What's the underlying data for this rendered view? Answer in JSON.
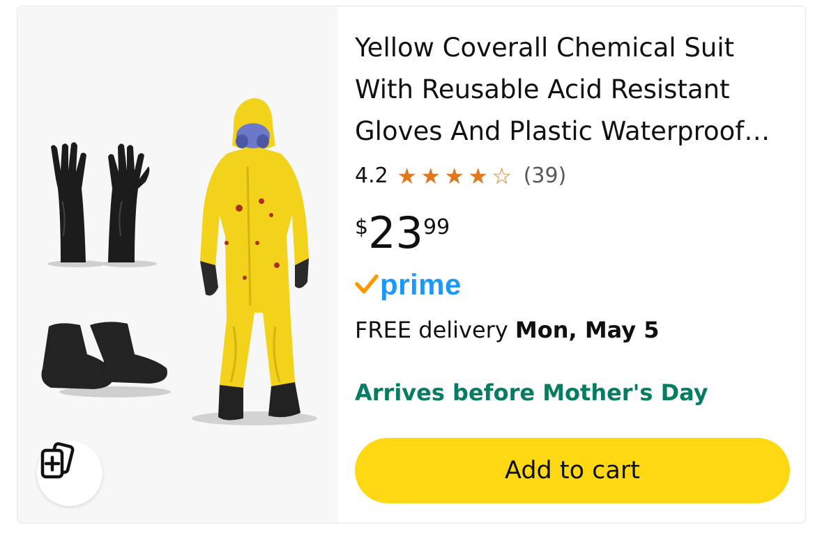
{
  "product": {
    "title": "Yellow Coverall Chemical Suit With Reusable Acid Resistant Gloves And Plastic Waterproof Boot Covers",
    "rating": "4.2",
    "rating_stars": 4.2,
    "review_count": "(39)",
    "price": {
      "symbol": "$",
      "whole": "23",
      "fraction": "99"
    },
    "badge": "prime",
    "delivery": {
      "prefix": "FREE delivery",
      "date": "Mon, May 5"
    },
    "arrives_note": "Arrives before Mother's Day",
    "add_to_cart_label": "Add to cart"
  },
  "colors": {
    "star": "#de7921",
    "prime_blue": "#1a98ff",
    "prime_check": "#ff9900",
    "arrives_green": "#067d62",
    "cart_button": "#ffd814",
    "suit_yellow": "#f2d21b"
  },
  "icons": {
    "compare": "compare-cards-icon"
  }
}
